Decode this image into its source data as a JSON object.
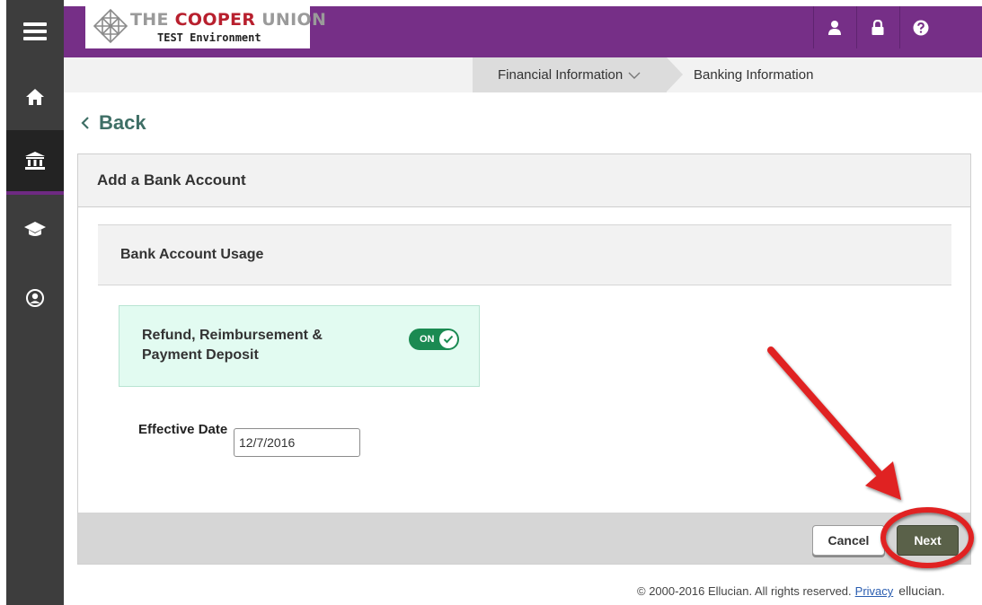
{
  "logo": {
    "line1_the": "THE",
    "line1_cooper": "COOPER",
    "line1_union": "UNION",
    "line2": "TEST Environment"
  },
  "nav_rail": {
    "items": [
      {
        "icon": "menu-icon"
      },
      {
        "icon": "home-icon"
      },
      {
        "icon": "bank-icon",
        "active": true
      },
      {
        "icon": "graduation-cap-icon"
      },
      {
        "icon": "user-circle-icon"
      }
    ]
  },
  "top_icons": [
    "user-icon",
    "lock-icon",
    "help-icon"
  ],
  "breadcrumb": {
    "items": [
      "Financial Information",
      "Banking Information"
    ]
  },
  "back": {
    "label": "Back"
  },
  "card": {
    "title": "Add a Bank Account",
    "section_title": "Bank Account Usage",
    "usage": {
      "label": "Refund, Reimbursement & Payment Deposit",
      "toggle_label": "ON"
    },
    "effective_date": {
      "label": "Effective Date",
      "value": "12/7/2016"
    },
    "buttons": {
      "cancel": "Cancel",
      "next": "Next"
    }
  },
  "footer": {
    "copyright": "© 2000-2016 Ellucian. All rights reserved.",
    "privacy": "Privacy",
    "brand": "ellucian."
  },
  "colors": {
    "topbar": "#762f87",
    "rail": "#3d3d3d",
    "toggle_on": "#1b8a52",
    "next_button": "#5a6149",
    "annotation": "#e02020"
  }
}
